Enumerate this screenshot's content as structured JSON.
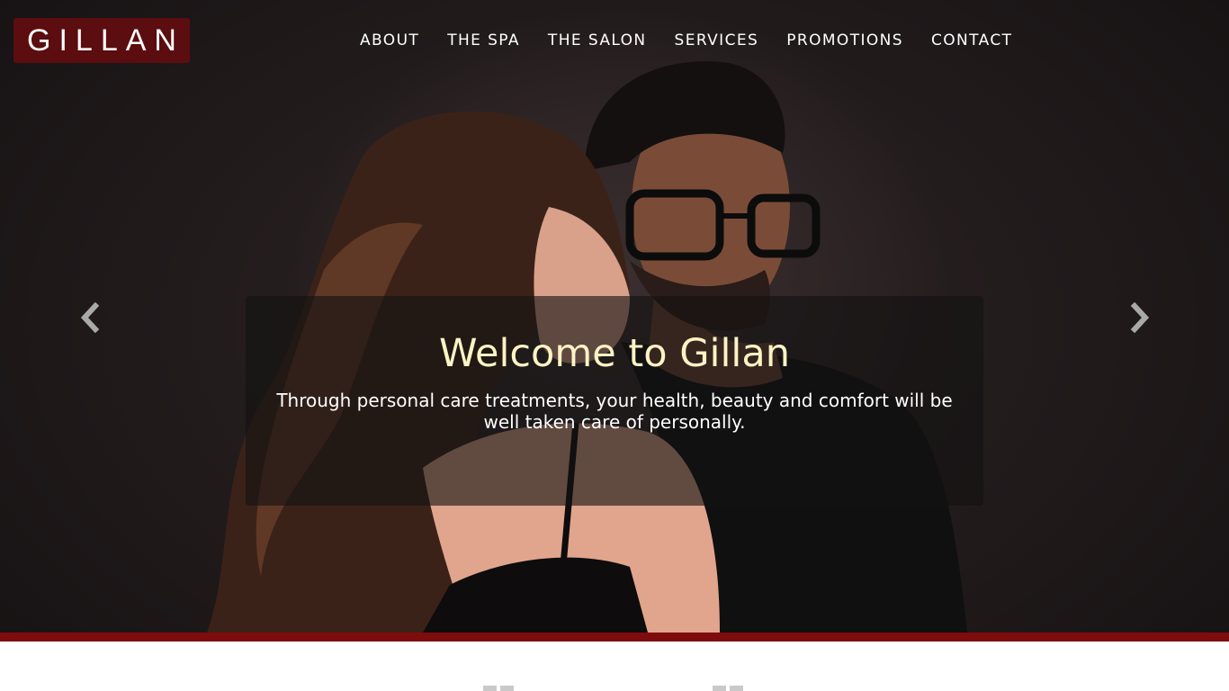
{
  "brand": {
    "logo_text": "GILLAN",
    "accent_color": "#7e0c0c",
    "logo_bg": "#5b0d0f"
  },
  "nav": {
    "items": [
      {
        "label": "ABOUT"
      },
      {
        "label": "THE SPA"
      },
      {
        "label": "THE SALON"
      },
      {
        "label": "SERVICES"
      },
      {
        "label": "PROMOTIONS"
      },
      {
        "label": "CONTACT"
      }
    ]
  },
  "hero": {
    "title": "Welcome to Gillan",
    "subtitle": "Through personal care treatments, your health, beauty and comfort will be well taken care of personally.",
    "title_color": "#fbf3c4",
    "prev_icon": "chevron-left-icon",
    "next_icon": "chevron-right-icon"
  },
  "features": {
    "icons": [
      "grid-icon",
      "grid-icon"
    ]
  }
}
